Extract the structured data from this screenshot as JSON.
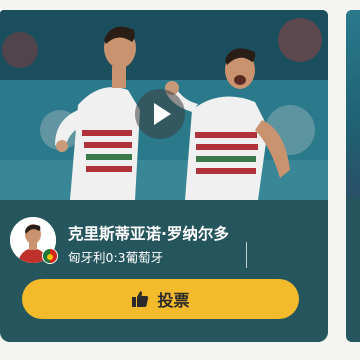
{
  "card": {
    "player_name": "克里斯蒂亚诺·罗纳尔多",
    "match_info": "匈牙利0:3葡萄牙",
    "vote_label": "投票"
  },
  "icons": {
    "play": "play-icon",
    "thumb": "thumbs-up-icon",
    "flag": "portugal-flag-icon"
  },
  "colors": {
    "card_background": "#25555d",
    "vote_button": "#f3bb2c",
    "text": "#ffffff"
  }
}
